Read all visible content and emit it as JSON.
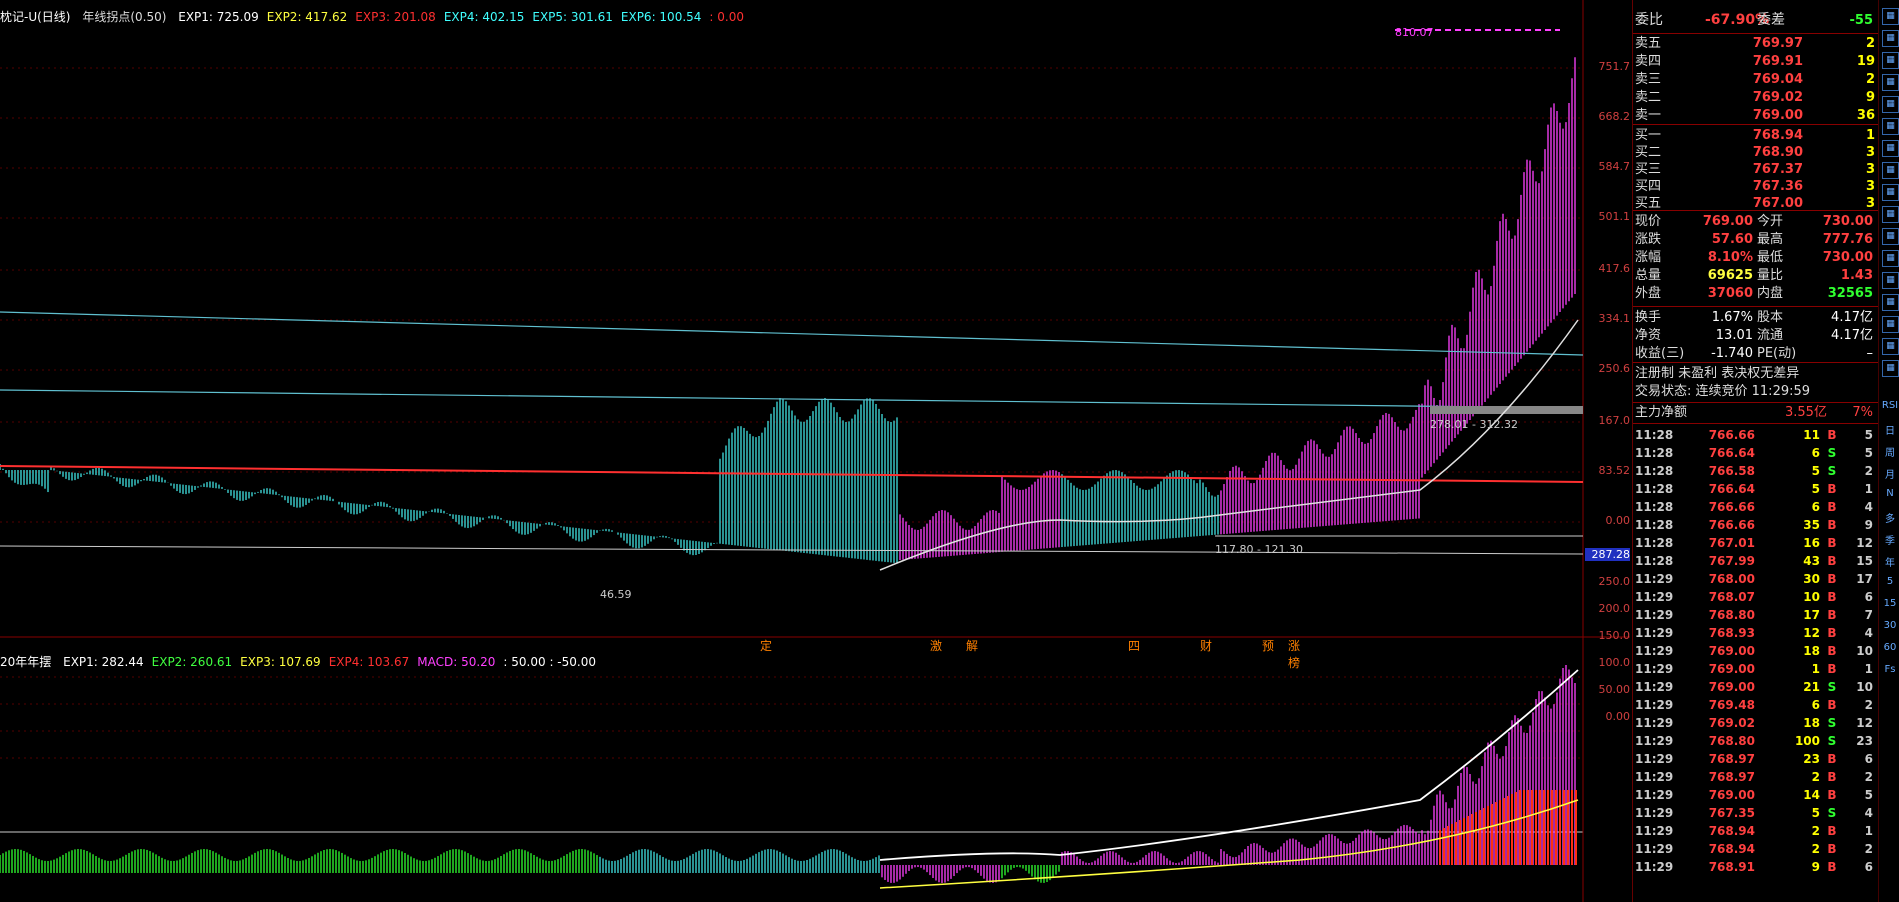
{
  "main_legend": {
    "name": "枕记-U(日线)",
    "indicator": "年线拐点(0.50)",
    "items": [
      {
        "label": "EXP1: 725.09",
        "color": "#ffffff"
      },
      {
        "label": "EXP2: 417.62",
        "color": "#ffff40"
      },
      {
        "label": "EXP3: 201.08",
        "color": "#ff3030"
      },
      {
        "label": "EXP4: 402.15",
        "color": "#40ffff"
      },
      {
        "label": "EXP5: 301.61",
        "color": "#40ffff"
      },
      {
        "label": "EXP6: 100.54",
        "color": "#40ffff"
      },
      {
        "label": ": 0.00",
        "color": "#ff3030"
      }
    ],
    "peak_label": "810.07",
    "low_label": "46.59",
    "range_label": "117.80 - 121.30",
    "range_label2": "278.01 - 312.32"
  },
  "main_axis": [
    "751.7",
    "668.2",
    "584.7",
    "501.1",
    "417.6",
    "334.1",
    "250.6",
    "167.0",
    "83.52",
    "0.00"
  ],
  "events": [
    {
      "text": "定"
    },
    {
      "text": "激"
    },
    {
      "text": "解"
    },
    {
      "text": "四"
    },
    {
      "text": "财"
    },
    {
      "text": "预"
    },
    {
      "text": "涨榜"
    }
  ],
  "sub_legend": {
    "name": "20年年摆",
    "items": [
      {
        "label": "EXP1: 282.44",
        "color": "#ffffff"
      },
      {
        "label": "EXP2: 260.61",
        "color": "#40ff40"
      },
      {
        "label": "EXP3: 107.69",
        "color": "#ffff40"
      },
      {
        "label": "EXP4: 103.67",
        "color": "#ff3030"
      },
      {
        "label": "MACD: 50.20",
        "color": "#ff40ff"
      },
      {
        "label": ": 50.00 : -50.00",
        "color": "#ffffff"
      }
    ]
  },
  "sub_axis": [
    "287.28",
    "250.0",
    "200.0",
    "150.0",
    "100.0",
    "50.00",
    "0.00"
  ],
  "quote": {
    "weibi_label": "委比",
    "weibi": "-67.90%",
    "weicha_label": "委差",
    "weicha": "-55",
    "asks": [
      {
        "label": "卖五",
        "price": "769.97",
        "vol": "2"
      },
      {
        "label": "卖四",
        "price": "769.91",
        "vol": "19"
      },
      {
        "label": "卖三",
        "price": "769.04",
        "vol": "2"
      },
      {
        "label": "卖二",
        "price": "769.02",
        "vol": "9"
      },
      {
        "label": "卖一",
        "price": "769.00",
        "vol": "36"
      }
    ],
    "bids": [
      {
        "label": "买一",
        "price": "768.94",
        "vol": "1"
      },
      {
        "label": "买二",
        "price": "768.90",
        "vol": "3"
      },
      {
        "label": "买三",
        "price": "767.37",
        "vol": "3"
      },
      {
        "label": "买四",
        "price": "767.36",
        "vol": "3"
      },
      {
        "label": "买五",
        "price": "767.00",
        "vol": "3"
      }
    ],
    "stats": [
      {
        "l1": "现价",
        "v1": "769.00",
        "c1": "red",
        "l2": "今开",
        "v2": "730.00",
        "c2": "red"
      },
      {
        "l1": "涨跌",
        "v1": "57.60",
        "c1": "red",
        "l2": "最高",
        "v2": "777.76",
        "c2": "red"
      },
      {
        "l1": "涨幅",
        "v1": "8.10%",
        "c1": "red",
        "l2": "最低",
        "v2": "730.00",
        "c2": "red"
      },
      {
        "l1": "总量",
        "v1": "69625",
        "c1": "yellow",
        "l2": "量比",
        "v2": "1.43",
        "c2": "red"
      },
      {
        "l1": "外盘",
        "v1": "37060",
        "c1": "red",
        "l2": "内盘",
        "v2": "32565",
        "c2": "green"
      }
    ],
    "stats2": [
      {
        "l1": "换手",
        "v1": "1.67%",
        "l2": "股本",
        "v2": "4.17亿"
      },
      {
        "l1": "净资",
        "v1": "13.01",
        "l2": "流通",
        "v2": "4.17亿"
      },
      {
        "l1": "收益(三)",
        "v1": "-1.740",
        "l2": "PE(动)",
        "v2": "–"
      }
    ],
    "notice": "注册制 未盈利 表决权无差异",
    "trade_state": "交易状态: 连续竞价 11:29:59",
    "main_flow_label": "主力净额",
    "main_flow": "3.55亿",
    "main_flow_pct": "7%"
  },
  "ticks": [
    {
      "t": "11:28",
      "p": "766.66",
      "v": "11",
      "d": "B",
      "n": "5"
    },
    {
      "t": "11:28",
      "p": "766.64",
      "v": "6",
      "d": "S",
      "n": "5"
    },
    {
      "t": "11:28",
      "p": "766.58",
      "v": "5",
      "d": "S",
      "n": "2"
    },
    {
      "t": "11:28",
      "p": "766.64",
      "v": "5",
      "d": "B",
      "n": "1"
    },
    {
      "t": "11:28",
      "p": "766.66",
      "v": "6",
      "d": "B",
      "n": "4"
    },
    {
      "t": "11:28",
      "p": "766.66",
      "v": "35",
      "d": "B",
      "n": "9"
    },
    {
      "t": "11:28",
      "p": "767.01",
      "v": "16",
      "d": "B",
      "n": "12"
    },
    {
      "t": "11:28",
      "p": "767.99",
      "v": "43",
      "d": "B",
      "n": "15"
    },
    {
      "t": "11:29",
      "p": "768.00",
      "v": "30",
      "d": "B",
      "n": "17"
    },
    {
      "t": "11:29",
      "p": "768.07",
      "v": "10",
      "d": "B",
      "n": "6"
    },
    {
      "t": "11:29",
      "p": "768.80",
      "v": "17",
      "d": "B",
      "n": "7"
    },
    {
      "t": "11:29",
      "p": "768.93",
      "v": "12",
      "d": "B",
      "n": "4"
    },
    {
      "t": "11:29",
      "p": "769.00",
      "v": "18",
      "d": "B",
      "n": "10"
    },
    {
      "t": "11:29",
      "p": "769.00",
      "v": "1",
      "d": "B",
      "n": "1"
    },
    {
      "t": "11:29",
      "p": "769.00",
      "v": "21",
      "d": "S",
      "n": "10"
    },
    {
      "t": "11:29",
      "p": "769.48",
      "v": "6",
      "d": "B",
      "n": "2"
    },
    {
      "t": "11:29",
      "p": "769.02",
      "v": "18",
      "d": "S",
      "n": "12"
    },
    {
      "t": "11:29",
      "p": "768.80",
      "v": "100",
      "d": "S",
      "n": "23"
    },
    {
      "t": "11:29",
      "p": "768.97",
      "v": "23",
      "d": "B",
      "n": "6"
    },
    {
      "t": "11:29",
      "p": "768.97",
      "v": "2",
      "d": "B",
      "n": "2"
    },
    {
      "t": "11:29",
      "p": "769.00",
      "v": "14",
      "d": "B",
      "n": "5"
    },
    {
      "t": "11:29",
      "p": "767.35",
      "v": "5",
      "d": "S",
      "n": "4"
    },
    {
      "t": "11:29",
      "p": "768.94",
      "v": "2",
      "d": "B",
      "n": "1"
    },
    {
      "t": "11:29",
      "p": "768.94",
      "v": "2",
      "d": "B",
      "n": "2"
    },
    {
      "t": "11:29",
      "p": "768.91",
      "v": "9",
      "d": "B",
      "n": "6"
    }
  ],
  "tools": [
    "RSI",
    "日",
    "周",
    "月",
    "N",
    "多",
    "季",
    "年",
    "5",
    "15",
    "30",
    "60",
    "Fs"
  ]
}
